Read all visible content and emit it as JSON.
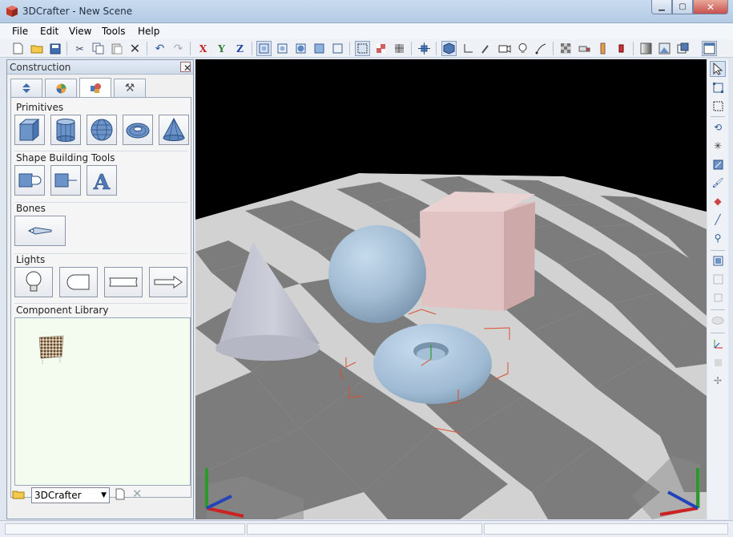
{
  "window": {
    "title": "3DCrafter - New Scene",
    "minimize_glyph": "▁",
    "maximize_glyph": "▢",
    "close_glyph": "✕"
  },
  "menu": [
    {
      "label": "File"
    },
    {
      "label": "Edit"
    },
    {
      "label": "View"
    },
    {
      "label": "Tools"
    },
    {
      "label": "Help"
    }
  ],
  "toolbar": {
    "axis_x": "X",
    "axis_y": "Y",
    "axis_z": "Z"
  },
  "panel": {
    "title": "Construction",
    "close_glyph": "✕",
    "tabs": [
      {
        "icon": "updown-arrows-icon"
      },
      {
        "icon": "material-ball-icon"
      },
      {
        "icon": "shapes-icon"
      },
      {
        "icon": "tools-icon"
      }
    ],
    "sections": {
      "primitives": "Primitives",
      "shape_tools": "Shape Building Tools",
      "bones": "Bones",
      "lights": "Lights",
      "library": "Component Library"
    },
    "primitives": [
      "cube-icon",
      "cylinder-icon",
      "sphere-icon",
      "torus-icon",
      "cone-icon"
    ],
    "library_select": "3DCrafter"
  },
  "colors": {
    "accent": "#4f79b5",
    "viewport_bg": "#000000",
    "floor_light": "#d4d4d4",
    "floor_dark": "#7e7e7e",
    "sphere": "#a9c3d8",
    "cube": "#e4c5c5",
    "cone": "#c5c7d3",
    "selection": "#d9502e",
    "axis_x": "#cc2222",
    "axis_y": "#2a9a2a",
    "axis_z": "#2344b8"
  }
}
